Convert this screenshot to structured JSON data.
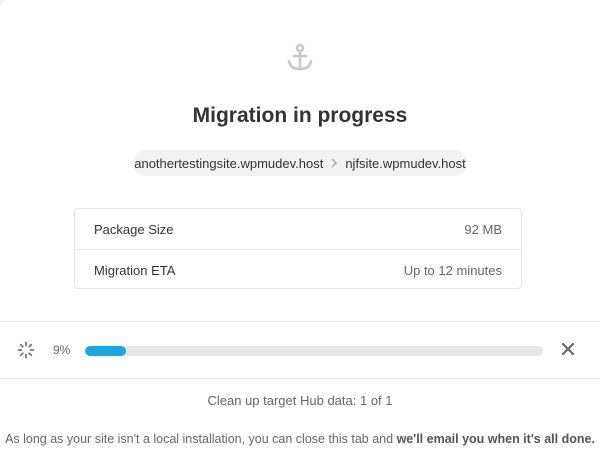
{
  "header": {
    "icon": "anchor-icon",
    "title": "Migration in progress"
  },
  "route": {
    "source": "anothertestingsite.wpmudev.host",
    "separator_icon": "chevron-right-icon",
    "target": "njfsite.wpmudev.host"
  },
  "details": [
    {
      "label": "Package Size",
      "value": "92 MB"
    },
    {
      "label": "Migration ETA",
      "value": "Up to 12 minutes"
    }
  ],
  "progress": {
    "spinner_icon": "loader-icon",
    "percent": 9,
    "percent_label": "9%",
    "close_icon": "close-icon",
    "accent_color": "#17a8e3"
  },
  "status": "Clean up target Hub data: 1 of 1",
  "note": {
    "text": "As long as your site isn't a local installation, you can close this tab and ",
    "emphasis": "we'll email you when it's all done."
  }
}
